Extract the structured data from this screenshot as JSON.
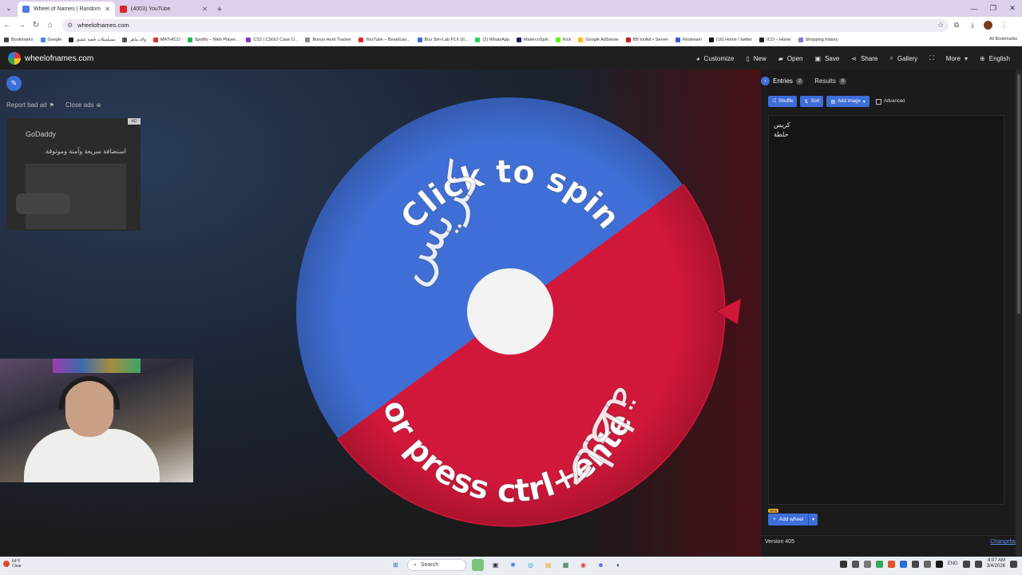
{
  "browser": {
    "tabs": [
      {
        "title": "Wheel of Names | Random nam",
        "active": true,
        "favicon_color": "#4f7be0"
      },
      {
        "title": "(4003) YouTube",
        "active": false,
        "favicon_color": "#e02424"
      }
    ],
    "url": "wheelofnames.com",
    "bookmarks": [
      {
        "label": "Bookmarks",
        "color": "#444444"
      },
      {
        "label": "Google",
        "color": "#4285f4"
      },
      {
        "label": "مسلسلات قصة عشق",
        "color": "#222222"
      },
      {
        "label": "ولاد ماهر",
        "color": "#555555"
      },
      {
        "label": "MATHICO",
        "color": "#e0342a"
      },
      {
        "label": "Spotify – Web Player...",
        "color": "#1db954"
      },
      {
        "label": "CS2 | CSGO Case O...",
        "color": "#8b2fc9"
      },
      {
        "label": "Bonus Hunt Tracker",
        "color": "#888888"
      },
      {
        "label": "YouTube – Broadcas...",
        "color": "#e02424"
      },
      {
        "label": "Buy Sim-Lab P1X Ul...",
        "color": "#3b6fd6"
      },
      {
        "label": "(2) WhatsApp",
        "color": "#25d366"
      },
      {
        "label": "MatercoSpin",
        "color": "#1a1a6e"
      },
      {
        "label": "Kick",
        "color": "#53fc18"
      },
      {
        "label": "Google AdSense",
        "color": "#fbbc04"
      },
      {
        "label": "BB toolkit • Server",
        "color": "#c21f1f"
      },
      {
        "label": "Restream",
        "color": "#3a5bd9"
      },
      {
        "label": "(16) Home / twitter",
        "color": "#111111"
      },
      {
        "label": "ICO – Home",
        "color": "#222222"
      },
      {
        "label": "Shopping history",
        "color": "#8a6fd6"
      }
    ],
    "all_bookmarks": "All Bookmarks"
  },
  "site": {
    "name": "wheelofnames.com",
    "nav": [
      "Customize",
      "New",
      "Open",
      "Save",
      "Share",
      "Gallery",
      "More",
      "English"
    ]
  },
  "stage": {
    "report_bad_ad": "Report bad ad",
    "close_ads": "Close ads",
    "ad": {
      "tag": "AD",
      "brand": "GoDaddy",
      "text": "استضافة سريعة وآمنة وموثوقة."
    }
  },
  "wheel": {
    "spin_text": "Click to spin",
    "press_text": "or press ctrl+enter",
    "colors": {
      "blue": "#3f6fd6",
      "red": "#d1173a",
      "center": "#f2f2f2"
    }
  },
  "panel": {
    "tabs": [
      {
        "label": "Entries",
        "count": "2"
      },
      {
        "label": "Results",
        "count": "0"
      }
    ],
    "shuffle": "Shuffle",
    "sort": "Sort",
    "add_image": "Add image",
    "advanced": "Advanced",
    "entries": [
      "كريس",
      "حلطة"
    ],
    "beta": "Beta",
    "add_wheel": "Add wheel",
    "version": "Version 405",
    "changelog": "Changelog"
  },
  "taskbar": {
    "weather_temp": "64°F",
    "weather_desc": "Clear",
    "search": "Search",
    "lang": "ENG",
    "time": "4:07 AM",
    "date": "3/4/2026"
  }
}
